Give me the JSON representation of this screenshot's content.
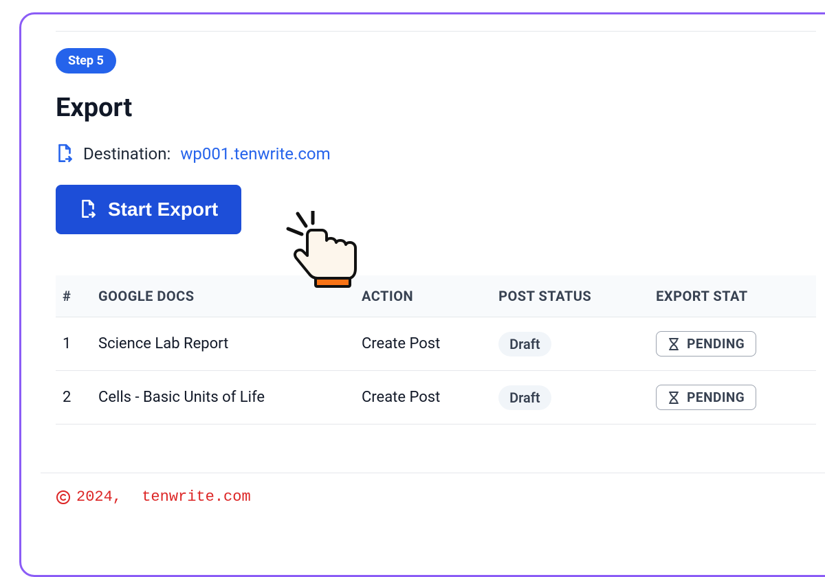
{
  "step_badge": "Step 5",
  "title": "Export",
  "destination": {
    "label": "Destination:",
    "value": "wp001.tenwrite.com"
  },
  "start_button": "Start Export",
  "table": {
    "headers": {
      "num": "#",
      "docs": "GOOGLE DOCS",
      "action": "ACTION",
      "post_status": "POST STATUS",
      "export_status": "EXPORT STAT"
    },
    "rows": [
      {
        "num": "1",
        "doc": "Science Lab Report",
        "action": "Create Post",
        "post_status": "Draft",
        "export_status": "PENDING"
      },
      {
        "num": "2",
        "doc": "Cells - Basic Units of Life",
        "action": "Create Post",
        "post_status": "Draft",
        "export_status": "PENDING"
      }
    ]
  },
  "footer": {
    "year": "2024,",
    "site": "tenwrite.com"
  }
}
